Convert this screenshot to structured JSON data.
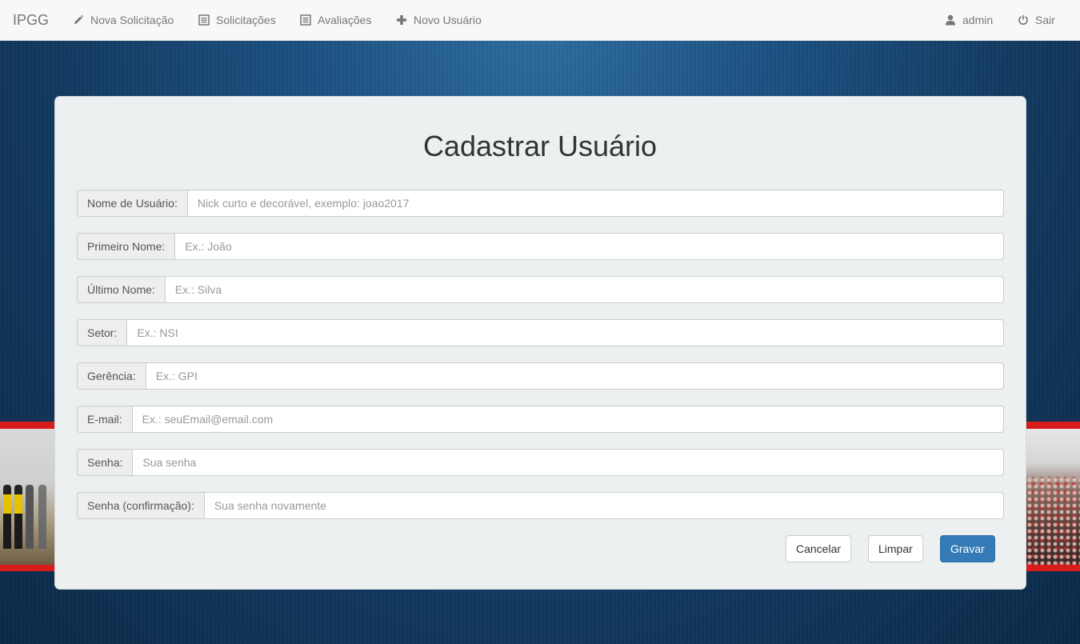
{
  "navbar": {
    "brand": "IPGG",
    "items": [
      {
        "label": "Nova Solicitação",
        "icon": "pencil-icon"
      },
      {
        "label": "Solicitações",
        "icon": "list-icon"
      },
      {
        "label": "Avaliações",
        "icon": "list-icon"
      },
      {
        "label": "Novo Usuário",
        "icon": "plus-icon"
      }
    ],
    "right": [
      {
        "label": "admin",
        "icon": "user-icon"
      },
      {
        "label": "Sair",
        "icon": "power-icon"
      }
    ]
  },
  "form": {
    "title": "Cadastrar Usuário",
    "fields": [
      {
        "label": "Nome de Usuário:",
        "placeholder": "Nick curto e decorável, exemplo: joao2017",
        "value": ""
      },
      {
        "label": "Primeiro Nome:",
        "placeholder": "Ex.: João",
        "value": ""
      },
      {
        "label": "Último Nome:",
        "placeholder": "Ex.: Silva",
        "value": ""
      },
      {
        "label": "Setor:",
        "placeholder": "Ex.: NSI",
        "value": ""
      },
      {
        "label": "Gerência:",
        "placeholder": "Ex.: GPI",
        "value": ""
      },
      {
        "label": "E-mail:",
        "placeholder": "Ex.: seuEmail@email.com",
        "value": ""
      },
      {
        "label": "Senha:",
        "placeholder": "Sua senha",
        "value": ""
      },
      {
        "label": "Senha (confirmação):",
        "placeholder": "Sua senha novamente",
        "value": ""
      }
    ],
    "buttons": {
      "cancel": "Cancelar",
      "clear": "Limpar",
      "save": "Gravar"
    }
  },
  "colors": {
    "primary": "#337ab7",
    "navbar_bg": "#f8f8f8",
    "panel_bg": "#ecf0f1",
    "banner_red": "#d81b1b"
  }
}
